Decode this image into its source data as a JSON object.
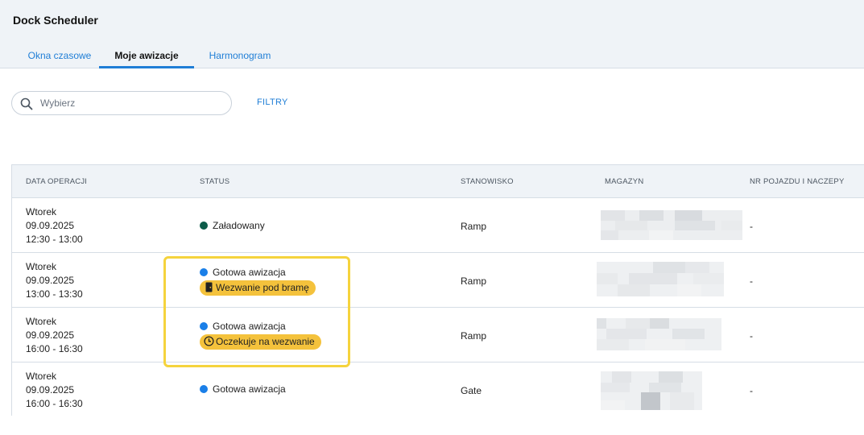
{
  "app": {
    "title": "Dock Scheduler"
  },
  "tabs": [
    {
      "label": "Okna czasowe",
      "active": false
    },
    {
      "label": "Moje awizacje",
      "active": true
    },
    {
      "label": "Harmonogram",
      "active": false
    }
  ],
  "search": {
    "placeholder": "Wybierz",
    "value": ""
  },
  "filters_label": "FILTRY",
  "table": {
    "columns": [
      "DATA OPERACJI",
      "STATUS",
      "STANOWISKO",
      "MAGAZYN",
      "NR POJAZDU I NACZEPY"
    ],
    "rows": [
      {
        "day": "Wtorek",
        "date": "09.09.2025",
        "time": "12:30 - 13:00",
        "status": "Załadowany",
        "status_color": "#0d5c4a",
        "badge": "",
        "badge_icon": "",
        "station": "Ramp",
        "vehicle": "-"
      },
      {
        "day": "Wtorek",
        "date": "09.09.2025",
        "time": "13:00 - 13:30",
        "status": "Gotowa awizacja",
        "status_color": "#1a7fe8",
        "badge": "Wezwanie pod bramę",
        "badge_icon": "door-icon",
        "station": "Ramp",
        "vehicle": "-"
      },
      {
        "day": "Wtorek",
        "date": "09.09.2025",
        "time": "16:00 - 16:30",
        "status": "Gotowa awizacja",
        "status_color": "#1a7fe8",
        "badge": "Oczekuje na wezwanie",
        "badge_icon": "clock-icon",
        "station": "Ramp",
        "vehicle": "-"
      },
      {
        "day": "Wtorek",
        "date": "09.09.2025",
        "time": "16:00 - 16:30",
        "status": "Gotowa awizacja",
        "status_color": "#1a7fe8",
        "badge": "",
        "badge_icon": "",
        "station": "Gate",
        "vehicle": "-"
      }
    ]
  },
  "colors": {
    "accent": "#1f7ed6",
    "badge": "#f4c23c",
    "highlight": "#f5d33d",
    "header_bg": "#eff3f7"
  }
}
